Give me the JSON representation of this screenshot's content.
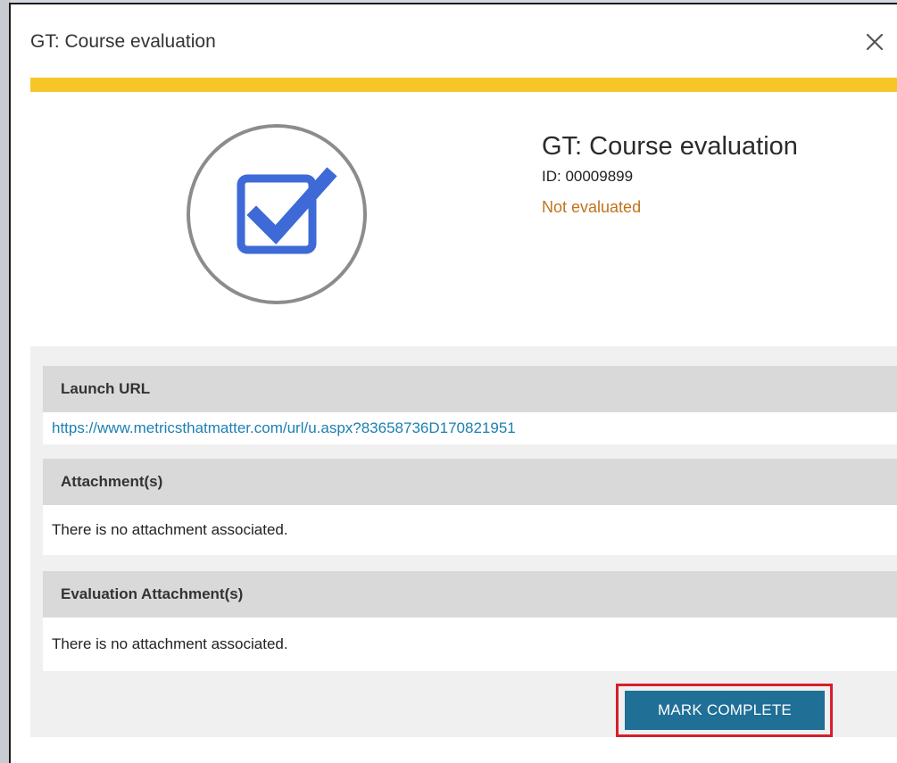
{
  "modal": {
    "title": "GT: Course evaluation",
    "close_icon": "close-icon"
  },
  "colors": {
    "accent": "#f6c628",
    "primary_button": "#1f6f96",
    "status": "#c0731b",
    "link": "#1d7fb0",
    "icon": "#3d6ad6",
    "highlight": "#d61f2b"
  },
  "item": {
    "icon": "checkbox-checked-icon",
    "title": "GT: Course evaluation",
    "id": "ID: 00009899",
    "status": "Not evaluated"
  },
  "sections": {
    "launch_url": {
      "header": "Launch URL",
      "url": "https://www.metricsthatmatter.com/url/u.aspx?83658736D170821951"
    },
    "attachments": {
      "header": "Attachment(s)",
      "body": "There is no attachment associated."
    },
    "evaluation_attachments": {
      "header": "Evaluation Attachment(s)",
      "body": "There is no attachment associated."
    }
  },
  "actions": {
    "mark_complete_label": "MARK COMPLETE"
  }
}
